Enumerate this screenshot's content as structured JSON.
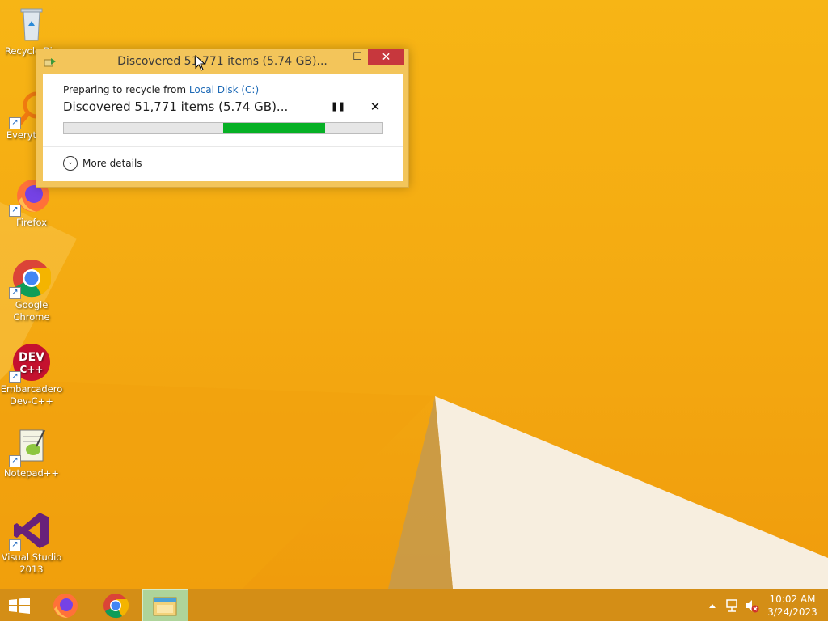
{
  "desktop": {
    "icons": [
      {
        "label": "Recycle Bin",
        "icon": "recycle-bin-icon"
      },
      {
        "label": "Everything",
        "icon": "everything-search-icon"
      },
      {
        "label": "Firefox",
        "icon": "firefox-icon"
      },
      {
        "label": "Google Chrome",
        "icon": "chrome-icon"
      },
      {
        "label": "Embarcadero Dev-C++",
        "icon": "devcpp-icon"
      },
      {
        "label": "Notepad++",
        "icon": "notepadpp-icon"
      },
      {
        "label": "Visual Studio 2013",
        "icon": "visual-studio-icon"
      }
    ]
  },
  "dialog": {
    "title": "Discovered 51,771 items (5.74 GB)...",
    "preparing_prefix": "Preparing to recycle from ",
    "source": "Local Disk (C:)",
    "status": "Discovered 51,771 items (5.74 GB)...",
    "progress": {
      "start": 0.5,
      "end": 0.82,
      "indeterminate": true
    },
    "more_details": "More details",
    "min_glyph": "—",
    "max_glyph": "☐",
    "close_glyph": "✕",
    "pause_glyph": "❚❚",
    "cancel_glyph": "✕",
    "chevron_glyph": "⌄"
  },
  "taskbar": {
    "pinned": [
      "windows-start-icon",
      "firefox-icon",
      "chrome-icon",
      "file-explorer-icon"
    ],
    "time": "10:02 AM",
    "date": "3/24/2023",
    "tray_icons": [
      "show-hidden-icons-chevron-icon",
      "network-icon",
      "volume-muted-icon"
    ]
  },
  "colors": {
    "desktop": "#f6b114",
    "taskbar": "#d48e16",
    "dialog_frame": "#f3c55a",
    "close_button": "#c7373d",
    "progress_fill": "#06b025",
    "link": "#1e6ab6"
  }
}
